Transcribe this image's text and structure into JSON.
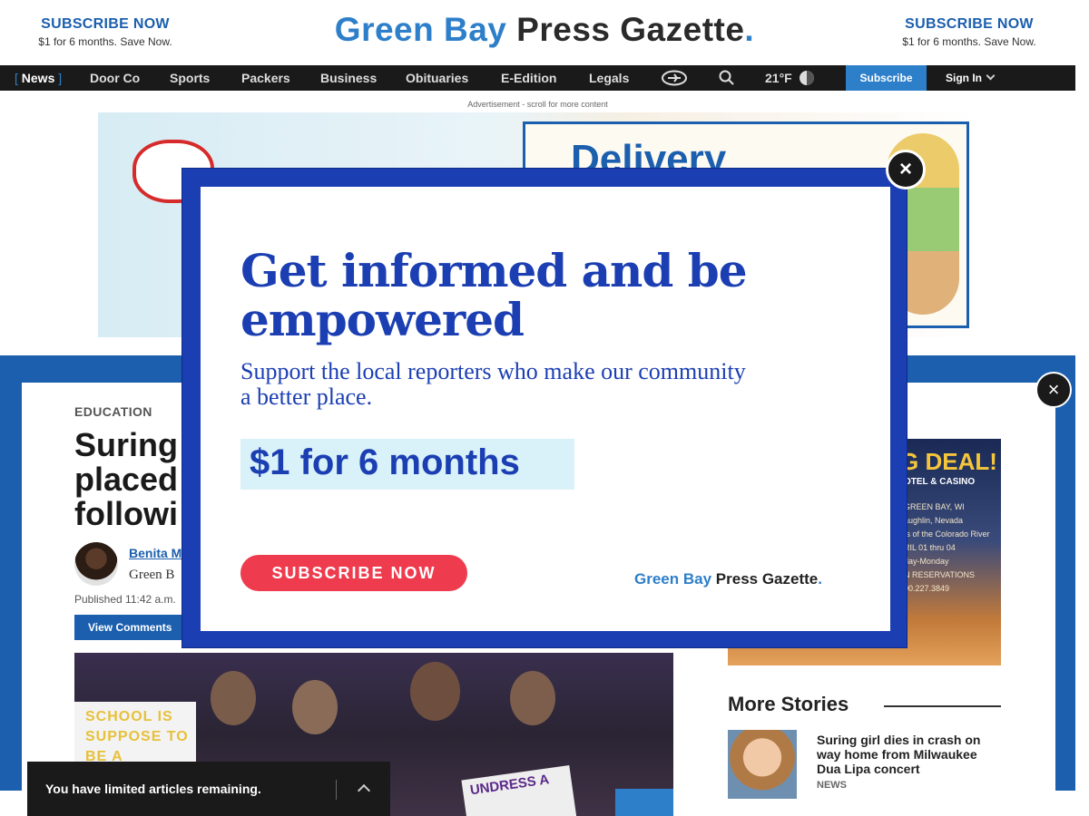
{
  "masthead": {
    "left_cta": {
      "title": "SUBSCRIBE NOW",
      "detail": "$1 for 6 months. Save Now."
    },
    "right_cta": {
      "title": "SUBSCRIBE NOW",
      "detail": "$1 for 6 months. Save Now."
    },
    "brand": {
      "part1": "Green Bay",
      "part2": "Press Gazette",
      "dot": "."
    }
  },
  "nav": {
    "items": [
      "News",
      "Door Co",
      "Sports",
      "Packers",
      "Business",
      "Obituaries",
      "E-Edition",
      "Legals"
    ],
    "active": "News",
    "weather": "21°F",
    "subscribe": "Subscribe",
    "signin": "Sign In",
    "icons": [
      "globe-icon",
      "search-icon",
      "weather-icon",
      "chevron-down-icon"
    ]
  },
  "ad": {
    "note": "Advertisement - scroll for more content",
    "headline": "Delivery"
  },
  "article": {
    "kicker": "EDUCATION",
    "headline_fragment": "Suring placed followi",
    "author": "Benita M",
    "org": "Green B",
    "published": "Published 11:42 a.m.",
    "view_comments": "View Comments",
    "photo_sign1": "SCHOOL IS SUPPOSE TO BE A",
    "photo_sign2": "UNDRESS A"
  },
  "side_ad": {
    "deal": "G DEAL!",
    "sub": "OTEL & CASINO",
    "lines": [
      "GREEN BAY, WI",
      "aughlin, Nevada",
      "ts of the Colorado River",
      "RIL 01 thru 04",
      "day-Monday",
      "N RESERVATIONS",
      "00.227.3849"
    ]
  },
  "more_stories": {
    "heading": "More Stories",
    "items": [
      {
        "title": "Suring girl dies in crash on way home from Milwaukee Dua Lipa concert",
        "tag": "NEWS"
      }
    ]
  },
  "limited_bar": {
    "text": "You have limited articles remaining."
  },
  "modal": {
    "heading": "Get informed and be empowered",
    "subtext": "Support the local reporters who make our community a better place.",
    "price": "$1 for 6 months",
    "cta": "SUBSCRIBE NOW",
    "brand": {
      "part1": "Green Bay",
      "part2": "Press Gazette",
      "dot": "."
    },
    "close": "×"
  },
  "colors": {
    "brand_blue": "#1b5fae",
    "modal_blue": "#1b3fb3",
    "cta_red": "#ee3b4e",
    "price_bg": "#d9f1f8"
  }
}
